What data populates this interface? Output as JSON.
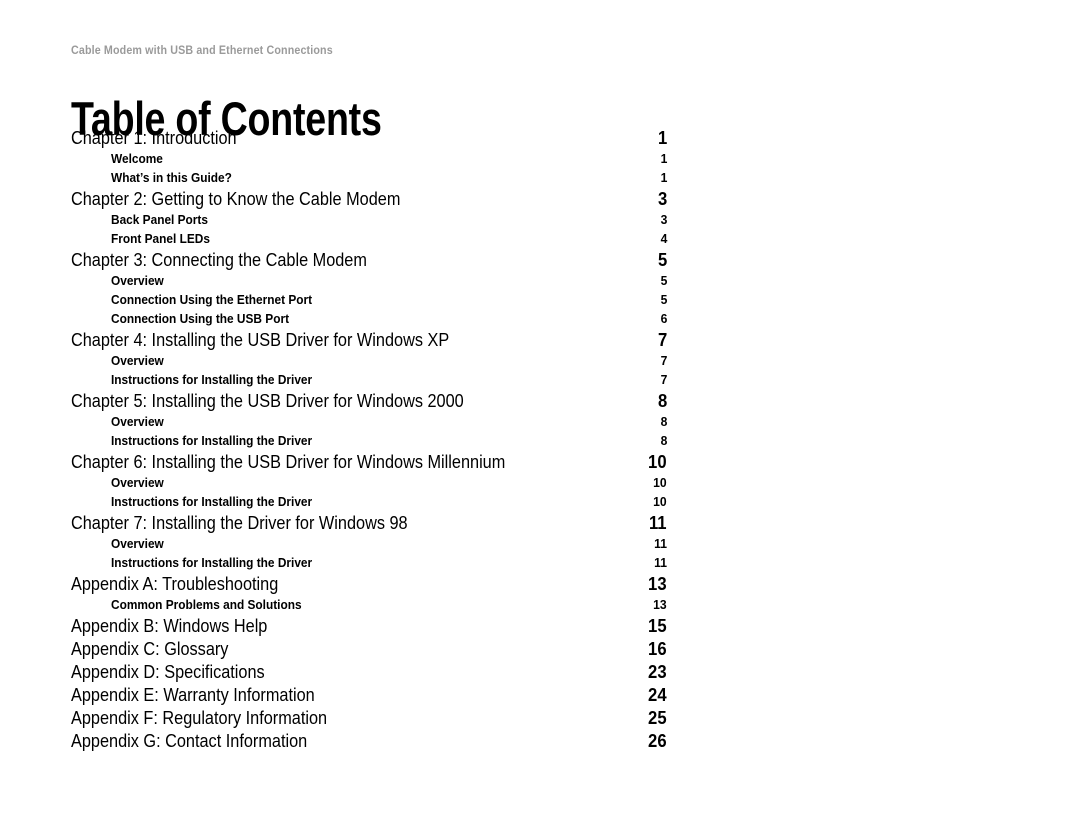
{
  "document": {
    "running_head": "Cable Modem with USB and Ethernet Connections",
    "title": "Table of Contents"
  },
  "toc": {
    "entries": [
      {
        "level": 1,
        "label": "Chapter 1: Introduction",
        "page": "1"
      },
      {
        "level": 2,
        "label": "Welcome",
        "page": "1"
      },
      {
        "level": 2,
        "label": "What’s in this Guide?",
        "page": "1"
      },
      {
        "level": 1,
        "label": "Chapter 2: Getting to Know the Cable Modem",
        "page": "3"
      },
      {
        "level": 2,
        "label": "Back Panel Ports",
        "page": "3"
      },
      {
        "level": 2,
        "label": "Front Panel LEDs",
        "page": "4"
      },
      {
        "level": 1,
        "label": "Chapter 3: Connecting the Cable Modem",
        "page": "5"
      },
      {
        "level": 2,
        "label": "Overview",
        "page": "5"
      },
      {
        "level": 2,
        "label": "Connection Using the Ethernet Port",
        "page": "5"
      },
      {
        "level": 2,
        "label": "Connection Using the USB Port",
        "page": "6"
      },
      {
        "level": 1,
        "label": "Chapter 4: Installing the USB Driver for Windows XP",
        "page": "7"
      },
      {
        "level": 2,
        "label": "Overview",
        "page": "7"
      },
      {
        "level": 2,
        "label": "Instructions for Installing the Driver",
        "page": "7"
      },
      {
        "level": 1,
        "label": "Chapter 5: Installing the USB Driver for Windows 2000",
        "page": "8"
      },
      {
        "level": 2,
        "label": "Overview",
        "page": "8"
      },
      {
        "level": 2,
        "label": "Instructions for Installing the Driver",
        "page": "8"
      },
      {
        "level": 1,
        "label": "Chapter 6: Installing the USB Driver for Windows Millennium",
        "page": "10"
      },
      {
        "level": 2,
        "label": "Overview",
        "page": "10"
      },
      {
        "level": 2,
        "label": "Instructions for Installing the Driver",
        "page": "10"
      },
      {
        "level": 1,
        "label": "Chapter 7: Installing the Driver for Windows 98",
        "page": "11"
      },
      {
        "level": 2,
        "label": "Overview",
        "page": "11"
      },
      {
        "level": 2,
        "label": "Instructions for Installing the Driver",
        "page": "11"
      },
      {
        "level": 1,
        "label": "Appendix A: Troubleshooting",
        "page": "13"
      },
      {
        "level": 2,
        "label": "Common Problems and Solutions",
        "page": "13"
      },
      {
        "level": 1,
        "label": "Appendix B: Windows Help",
        "page": "15"
      },
      {
        "level": 1,
        "label": "Appendix C: Glossary",
        "page": "16"
      },
      {
        "level": 1,
        "label": "Appendix D: Specifications",
        "page": "23"
      },
      {
        "level": 1,
        "label": "Appendix E: Warranty Information",
        "page": "24"
      },
      {
        "level": 1,
        "label": "Appendix F: Regulatory Information",
        "page": "25"
      },
      {
        "level": 1,
        "label": "Appendix G: Contact Information",
        "page": "26"
      }
    ]
  }
}
